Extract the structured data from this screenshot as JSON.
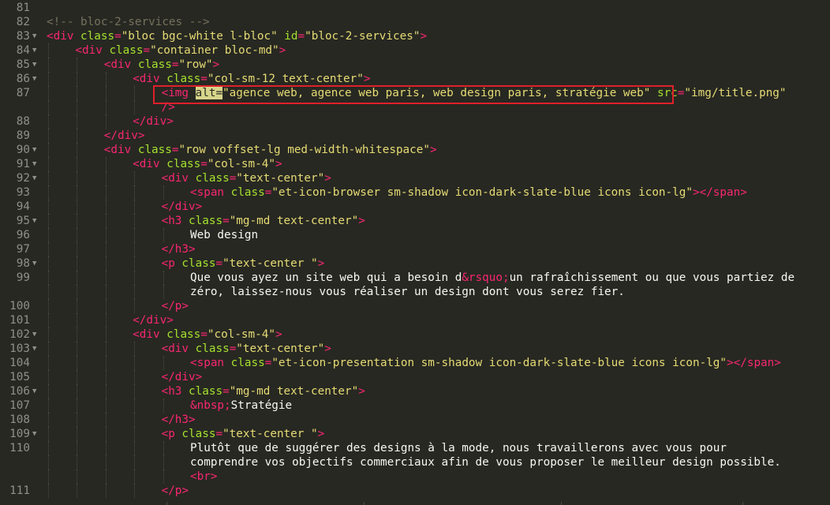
{
  "editor": {
    "language": "html",
    "theme_colors": {
      "background": "#272822",
      "tag": "#f92672",
      "attribute": "#a6e22e",
      "string": "#e6db74",
      "text": "#f8f8f2",
      "comment": "#75715e",
      "gutter": "#8f908a",
      "highlight_box": "#e0202a"
    },
    "lines": [
      {
        "num": "81",
        "fold": false,
        "indent": 0,
        "tokens": []
      },
      {
        "num": "82",
        "fold": false,
        "indent": 0,
        "tokens": [
          [
            "cmt",
            "<!-- bloc-2-services -->"
          ]
        ]
      },
      {
        "num": "83",
        "fold": true,
        "indent": 0,
        "tokens": [
          [
            "tag",
            "<div"
          ],
          [
            "txt",
            " "
          ],
          [
            "attr",
            "class"
          ],
          [
            "tag",
            "="
          ],
          [
            "str",
            "\"bloc bgc-white l-bloc\""
          ],
          [
            "txt",
            " "
          ],
          [
            "attr",
            "id"
          ],
          [
            "tag",
            "="
          ],
          [
            "str",
            "\"bloc-2-services\""
          ],
          [
            "tag",
            ">"
          ]
        ]
      },
      {
        "num": "84",
        "fold": true,
        "indent": 1,
        "tokens": [
          [
            "tag",
            "<div"
          ],
          [
            "txt",
            " "
          ],
          [
            "attr",
            "class"
          ],
          [
            "tag",
            "="
          ],
          [
            "str",
            "\"container bloc-md\""
          ],
          [
            "tag",
            ">"
          ]
        ]
      },
      {
        "num": "85",
        "fold": true,
        "indent": 2,
        "tokens": [
          [
            "tag",
            "<div"
          ],
          [
            "txt",
            " "
          ],
          [
            "attr",
            "class"
          ],
          [
            "tag",
            "="
          ],
          [
            "str",
            "\"row\""
          ],
          [
            "tag",
            ">"
          ]
        ]
      },
      {
        "num": "86",
        "fold": true,
        "indent": 3,
        "tokens": [
          [
            "tag",
            "<div"
          ],
          [
            "txt",
            " "
          ],
          [
            "attr",
            "class"
          ],
          [
            "tag",
            "="
          ],
          [
            "str",
            "\"col-sm-12 text-center\""
          ],
          [
            "tag",
            ">"
          ]
        ]
      },
      {
        "num": "87",
        "fold": false,
        "indent": 4,
        "tokens": [
          [
            "tag",
            "<img"
          ],
          [
            "txt",
            " "
          ],
          [
            "hl",
            "alt="
          ],
          [
            "str",
            "\"agence web, agence web paris, web design paris, stratégie web\""
          ],
          [
            "txt",
            " "
          ],
          [
            "attr",
            "src"
          ],
          [
            "tag",
            "="
          ],
          [
            "str",
            "\"img/title.png\""
          ]
        ]
      },
      {
        "num": "",
        "fold": false,
        "indent": 4,
        "tokens": [
          [
            "tag",
            "/>"
          ]
        ]
      },
      {
        "num": "88",
        "fold": false,
        "indent": 3,
        "tokens": [
          [
            "tag",
            "</div>"
          ]
        ]
      },
      {
        "num": "89",
        "fold": false,
        "indent": 2,
        "tokens": [
          [
            "tag",
            "</div>"
          ]
        ]
      },
      {
        "num": "90",
        "fold": true,
        "indent": 2,
        "tokens": [
          [
            "tag",
            "<div"
          ],
          [
            "txt",
            " "
          ],
          [
            "attr",
            "class"
          ],
          [
            "tag",
            "="
          ],
          [
            "str",
            "\"row voffset-lg med-width-whitespace\""
          ],
          [
            "tag",
            ">"
          ]
        ]
      },
      {
        "num": "91",
        "fold": true,
        "indent": 3,
        "tokens": [
          [
            "tag",
            "<div"
          ],
          [
            "txt",
            " "
          ],
          [
            "attr",
            "class"
          ],
          [
            "tag",
            "="
          ],
          [
            "str",
            "\"col-sm-4\""
          ],
          [
            "tag",
            ">"
          ]
        ]
      },
      {
        "num": "92",
        "fold": true,
        "indent": 4,
        "tokens": [
          [
            "tag",
            "<div"
          ],
          [
            "txt",
            " "
          ],
          [
            "attr",
            "class"
          ],
          [
            "tag",
            "="
          ],
          [
            "str",
            "\"text-center\""
          ],
          [
            "tag",
            ">"
          ]
        ]
      },
      {
        "num": "93",
        "fold": false,
        "indent": 5,
        "tokens": [
          [
            "tag",
            "<span"
          ],
          [
            "txt",
            " "
          ],
          [
            "attr",
            "class"
          ],
          [
            "tag",
            "="
          ],
          [
            "str",
            "\"et-icon-browser sm-shadow icon-dark-slate-blue icons icon-lg\""
          ],
          [
            "tag",
            "></span>"
          ]
        ]
      },
      {
        "num": "94",
        "fold": false,
        "indent": 4,
        "tokens": [
          [
            "tag",
            "</div>"
          ]
        ]
      },
      {
        "num": "95",
        "fold": true,
        "indent": 4,
        "tokens": [
          [
            "tag",
            "<h3"
          ],
          [
            "txt",
            " "
          ],
          [
            "attr",
            "class"
          ],
          [
            "tag",
            "="
          ],
          [
            "str",
            "\"mg-md text-center\""
          ],
          [
            "tag",
            ">"
          ]
        ]
      },
      {
        "num": "96",
        "fold": false,
        "indent": 5,
        "tokens": [
          [
            "txt",
            "Web design"
          ]
        ]
      },
      {
        "num": "97",
        "fold": false,
        "indent": 4,
        "tokens": [
          [
            "tag",
            "</h3>"
          ]
        ]
      },
      {
        "num": "98",
        "fold": true,
        "indent": 4,
        "tokens": [
          [
            "tag",
            "<p"
          ],
          [
            "txt",
            " "
          ],
          [
            "attr",
            "class"
          ],
          [
            "tag",
            "="
          ],
          [
            "str",
            "\"text-center \""
          ],
          [
            "tag",
            ">"
          ]
        ]
      },
      {
        "num": "99",
        "fold": false,
        "indent": 5,
        "tokens": [
          [
            "txt",
            "Que vous ayez un site web qui a besoin d"
          ],
          [
            "tag",
            "&rsquo;"
          ],
          [
            "txt",
            "un rafraîchissement ou que vous partiez de"
          ]
        ]
      },
      {
        "num": "",
        "fold": false,
        "indent": 5,
        "tokens": [
          [
            "txt",
            "zéro, laissez-nous vous réaliser un design dont vous serez fier."
          ]
        ]
      },
      {
        "num": "100",
        "fold": false,
        "indent": 4,
        "tokens": [
          [
            "tag",
            "</p>"
          ]
        ]
      },
      {
        "num": "101",
        "fold": false,
        "indent": 3,
        "tokens": [
          [
            "tag",
            "</div>"
          ]
        ]
      },
      {
        "num": "102",
        "fold": true,
        "indent": 3,
        "tokens": [
          [
            "tag",
            "<div"
          ],
          [
            "txt",
            " "
          ],
          [
            "attr",
            "class"
          ],
          [
            "tag",
            "="
          ],
          [
            "str",
            "\"col-sm-4\""
          ],
          [
            "tag",
            ">"
          ]
        ]
      },
      {
        "num": "103",
        "fold": true,
        "indent": 4,
        "tokens": [
          [
            "tag",
            "<div"
          ],
          [
            "txt",
            " "
          ],
          [
            "attr",
            "class"
          ],
          [
            "tag",
            "="
          ],
          [
            "str",
            "\"text-center\""
          ],
          [
            "tag",
            ">"
          ]
        ]
      },
      {
        "num": "104",
        "fold": false,
        "indent": 5,
        "tokens": [
          [
            "tag",
            "<span"
          ],
          [
            "txt",
            " "
          ],
          [
            "attr",
            "class"
          ],
          [
            "tag",
            "="
          ],
          [
            "str",
            "\"et-icon-presentation sm-shadow icon-dark-slate-blue icons icon-lg\""
          ],
          [
            "tag",
            "></span>"
          ]
        ]
      },
      {
        "num": "105",
        "fold": false,
        "indent": 4,
        "tokens": [
          [
            "tag",
            "</div>"
          ]
        ]
      },
      {
        "num": "106",
        "fold": true,
        "indent": 4,
        "tokens": [
          [
            "tag",
            "<h3"
          ],
          [
            "txt",
            " "
          ],
          [
            "attr",
            "class"
          ],
          [
            "tag",
            "="
          ],
          [
            "str",
            "\"mg-md text-center\""
          ],
          [
            "tag",
            ">"
          ]
        ]
      },
      {
        "num": "107",
        "fold": false,
        "indent": 5,
        "tokens": [
          [
            "tag",
            "&nbsp;"
          ],
          [
            "txt",
            "Stratégie"
          ]
        ]
      },
      {
        "num": "108",
        "fold": false,
        "indent": 4,
        "tokens": [
          [
            "tag",
            "</h3>"
          ]
        ]
      },
      {
        "num": "109",
        "fold": true,
        "indent": 4,
        "tokens": [
          [
            "tag",
            "<p"
          ],
          [
            "txt",
            " "
          ],
          [
            "attr",
            "class"
          ],
          [
            "tag",
            "="
          ],
          [
            "str",
            "\"text-center \""
          ],
          [
            "tag",
            ">"
          ]
        ]
      },
      {
        "num": "110",
        "fold": false,
        "indent": 5,
        "tokens": [
          [
            "txt",
            "Plutôt que de suggérer des designs à la mode, nous travaillerons avec vous pour"
          ]
        ]
      },
      {
        "num": "",
        "fold": false,
        "indent": 5,
        "tokens": [
          [
            "txt",
            "comprendre vos objectifs commerciaux afin de vous proposer le meilleur design possible."
          ]
        ]
      },
      {
        "num": "",
        "fold": false,
        "indent": 5,
        "tokens": [
          [
            "tag",
            "<br>"
          ]
        ]
      },
      {
        "num": "111",
        "fold": false,
        "indent": 4,
        "tokens": [
          [
            "tag",
            "</p>"
          ]
        ]
      }
    ]
  }
}
